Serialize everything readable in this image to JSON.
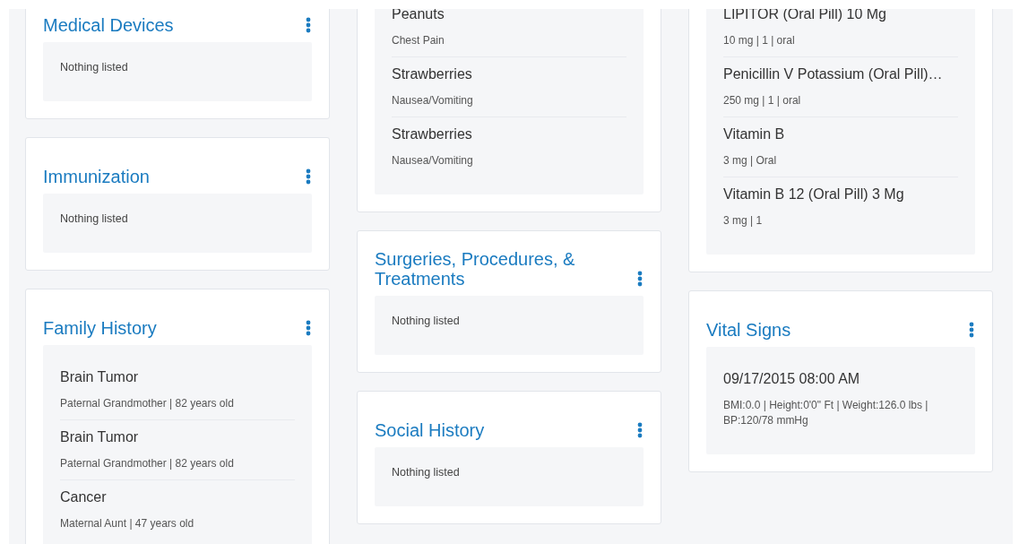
{
  "columns": [
    {
      "cards": [
        {
          "title": "Medical Devices",
          "empty_text": "Nothing listed"
        },
        {
          "title": "Immunization",
          "empty_text": "Nothing listed"
        },
        {
          "title": "Family History",
          "items": [
            {
              "name": "Brain Tumor",
              "detail": "Paternal Grandmother | 82 years old"
            },
            {
              "name": "Brain Tumor",
              "detail": "Paternal Grandmother | 82 years old"
            },
            {
              "name": "Cancer",
              "detail": "Maternal Aunt | 47 years old"
            }
          ]
        }
      ]
    },
    {
      "cards": [
        {
          "items": [
            {
              "name": "Peanuts",
              "detail": "Chest Pain"
            },
            {
              "name": "Strawberries",
              "detail": "Nausea/Vomiting"
            },
            {
              "name": "Strawberries",
              "detail": "Nausea/Vomiting"
            }
          ]
        },
        {
          "title": "Surgeries, Procedures, & Treatments",
          "empty_text": "Nothing listed"
        },
        {
          "title": "Social History",
          "empty_text": "Nothing listed"
        }
      ]
    },
    {
      "cards": [
        {
          "items": [
            {
              "name": "LIPITOR (Oral Pill) 10 Mg",
              "detail": "10 mg | 1 | oral"
            },
            {
              "name": "Penicillin V Potassium (Oral Pill)…",
              "detail": "250 mg | 1 | oral"
            },
            {
              "name": "Vitamin B",
              "detail": "3 mg | Oral"
            },
            {
              "name": "Vitamin B 12 (Oral Pill) 3 Mg",
              "detail": "3 mg | 1"
            }
          ]
        },
        {
          "title": "Vital Signs",
          "items": [
            {
              "name": "09/17/2015 08:00 AM",
              "detail": "BMI:0.0 | Height:0'0\" Ft | Weight:126.0 lbs | BP:120/78 mmHg"
            }
          ]
        }
      ]
    }
  ]
}
